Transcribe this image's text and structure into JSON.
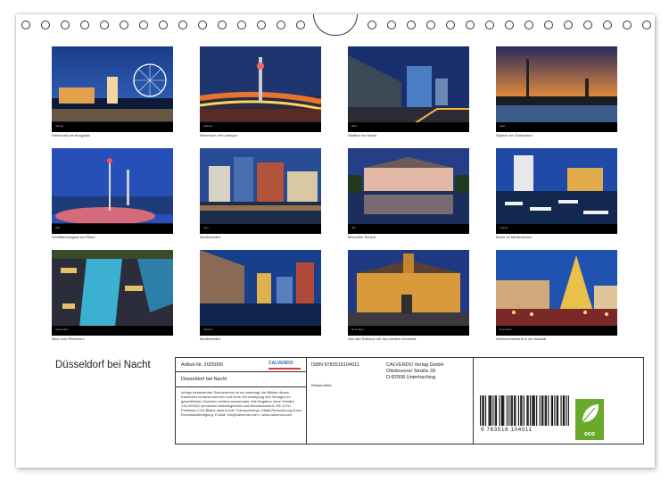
{
  "calendar": {
    "title": "Düsseldorf bei Nacht",
    "months": [
      {
        "label": "Januar",
        "caption": "Riesenrad am Burgplatz"
      },
      {
        "label": "Februar",
        "caption": "Rheinturm mit Lichtspur"
      },
      {
        "label": "März",
        "caption": "Stadttor bei Nacht"
      },
      {
        "label": "April",
        "caption": "Skyline von Düsseldorf"
      },
      {
        "label": "Mai",
        "caption": "Schifffahrtssignal am Rhein"
      },
      {
        "label": "Juni",
        "caption": "Medienhafen"
      },
      {
        "label": "Juli",
        "caption": "Benrather Schloß"
      },
      {
        "label": "August",
        "caption": "Boote im Medienhafen"
      },
      {
        "label": "September",
        "caption": "Blick vom Rheinturm"
      },
      {
        "label": "Oktober",
        "caption": "Medienhafen"
      },
      {
        "label": "November",
        "caption": "Das alte Rathaus mit Jan-Wellem-Denkmal"
      },
      {
        "label": "Dezember",
        "caption": "Weihnachtsmarkt in der Altstadt"
      }
    ]
  },
  "imprint": {
    "article": "Artikel-Nr. 2025000",
    "publisher_logo": "CALVENDO",
    "product_title": "Düsseldorf bei Nacht",
    "isbn": "ISBN 9783516104011",
    "author": "Rickard Abel",
    "publisher_name": "CALVENDO Verlag GmbH",
    "publisher_street": "Ottobrunner Straße 39",
    "publisher_city": "D-82008 Unterhaching",
    "legal_text": "Infolge bestehender Schutzrechte ist es untersagt, die Blätter dieses Kalenders herauszutrennen und ohne Genehmigung des Verlages zu gewerblichen Zwecken weiterzuverwenden. Alle Angaben ohne Gewähr. CALVENDO produziert bedarfsgerecht und klimabewusst in DE & EU. Professio-CO2-Bilanz dank kurzer Transportwege. Abfall-Reduzierung durch Einzelstückfertigung. E-Mail: info@calvendo.com • www.calvendo.com",
    "barcode_number": "9 783516 104011",
    "eco_label": "eco"
  },
  "colors": {
    "page_border": "#333333",
    "eco_green": "#6aaa2a",
    "plate_black": "#000000"
  }
}
